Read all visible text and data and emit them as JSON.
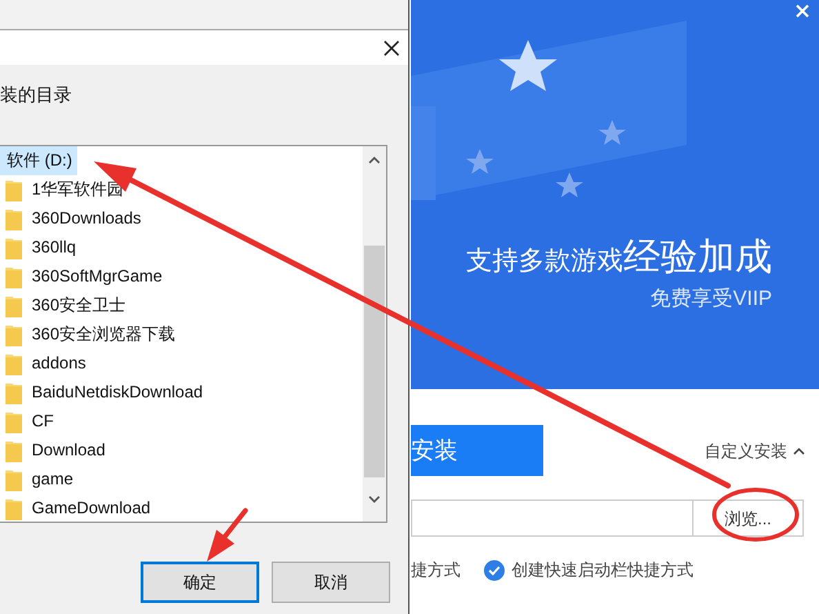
{
  "folder_dialog": {
    "prompt": "装的目录",
    "tree": [
      {
        "label": "软件 (D:)",
        "kind": "drive",
        "selected": true,
        "children": [
          {
            "label": "1华军软件园",
            "kind": "folder",
            "selected": false
          },
          {
            "label": "360Downloads",
            "kind": "folder",
            "selected": false
          },
          {
            "label": "360llq",
            "kind": "folder",
            "selected": false
          },
          {
            "label": "360SoftMgrGame",
            "kind": "folder",
            "selected": false
          },
          {
            "label": "360安全卫士",
            "kind": "folder",
            "selected": false
          },
          {
            "label": "360安全浏览器下载",
            "kind": "folder",
            "selected": false
          },
          {
            "label": "addons",
            "kind": "folder",
            "selected": false
          },
          {
            "label": "BaiduNetdiskDownload",
            "kind": "folder",
            "selected": false
          },
          {
            "label": "CF",
            "kind": "folder",
            "selected": false
          },
          {
            "label": "Download",
            "kind": "folder",
            "selected": false
          },
          {
            "label": "game",
            "kind": "folder",
            "selected": false
          },
          {
            "label": "GameDownload",
            "kind": "folder",
            "selected": false
          }
        ]
      }
    ],
    "buttons": [
      {
        "label": "确定",
        "default": true
      },
      {
        "label": "取消",
        "default": false
      }
    ]
  },
  "installer": {
    "banner": {
      "headline": "支持多款游戏",
      "headline_emphasis": "经验加成",
      "subline": "免费享受VIIP"
    },
    "install_button": "安装",
    "custom_install": {
      "label": "自定义安装",
      "expanded": true
    },
    "path_field": {
      "browse_button": "浏览..."
    },
    "shortcut_option_fragment": "捷方式",
    "quicklaunch_option": {
      "label": "创建快速启动栏快捷方式",
      "checked": true
    }
  }
}
